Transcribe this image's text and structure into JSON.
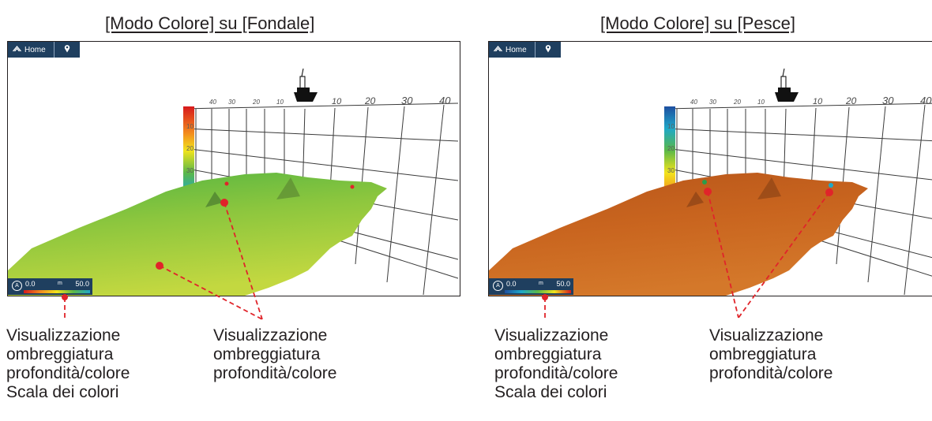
{
  "left_panel": {
    "title": "[Modo Colore] su [Fondale]",
    "home_label": "Home",
    "scale_min": "0.0",
    "scale_unit": "m",
    "scale_max": "50.0",
    "auto_label": "A",
    "scale_colors": [
      "#d7191c",
      "#f38a1d",
      "#f2e41c",
      "#5bb848",
      "#1ea8c8"
    ],
    "depth_bar_colors": [
      "#d7191c",
      "#f38a1d",
      "#f2e41c",
      "#5bb848",
      "#1ea8c8"
    ],
    "seabed_color": "#8cc63e"
  },
  "right_panel": {
    "title": "[Modo Colore] su [Pesce]",
    "home_label": "Home",
    "scale_min": "0.0",
    "scale_unit": "m",
    "scale_max": "50.0",
    "auto_label": "A",
    "scale_colors": [
      "#1e4fa0",
      "#1ea8c8",
      "#5bb848",
      "#f2e41c",
      "#d7191c"
    ],
    "depth_bar_colors": [
      "#1e4fa0",
      "#1ea8c8",
      "#5bb848",
      "#f2e41c",
      "#f38a1d"
    ],
    "seabed_color": "#c9651f"
  },
  "grid": {
    "left_ticks": [
      "40",
      "30",
      "20",
      "10"
    ],
    "right_ticks": [
      "10",
      "20",
      "30",
      "40"
    ],
    "depth_ticks": [
      "10",
      "20",
      "30"
    ]
  },
  "callouts": {
    "left_scale": [
      "Visualizzazione",
      "ombreggiatura",
      "profondità/colore",
      "Scala dei colori"
    ],
    "left_shading": [
      "Visualizzazione",
      "ombreggiatura",
      "profondità/colore"
    ],
    "right_scale": [
      "Visualizzazione",
      "ombreggiatura",
      "profondità/colore",
      "Scala dei colori"
    ],
    "right_shading": [
      "Visualizzazione",
      "ombreggiatura",
      "profondità/colore"
    ]
  },
  "colors": {
    "leader": "#e0242a",
    "panel_bg": "#1f3f5f"
  },
  "icons": {
    "home": "home-icon",
    "pin": "map-pin-icon",
    "boat": "boat-icon"
  }
}
